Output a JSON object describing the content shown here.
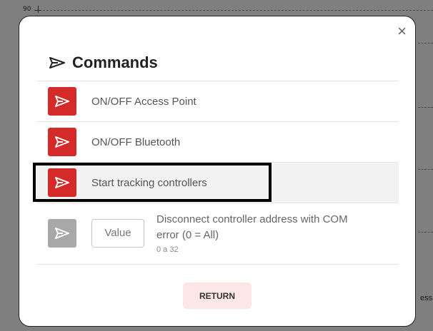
{
  "background": {
    "axis_label": "90",
    "right_text": "ess"
  },
  "modal": {
    "close_label": "×",
    "title": "Commands",
    "title_icon": "send-icon",
    "commands": [
      {
        "label": "ON/OFF Access Point",
        "icon": "send-icon",
        "color": "#d42a2a"
      },
      {
        "label": "ON/OFF Bluetooth",
        "icon": "send-icon",
        "color": "#d42a2a"
      },
      {
        "label": "Start tracking controllers",
        "icon": "send-icon",
        "color": "#d42a2a"
      }
    ],
    "param_command": {
      "input_placeholder": "Value",
      "description": "Disconnect controller address with COM error (0 = All)",
      "range": "0 a 32",
      "icon": "send-icon",
      "color": "#a8a8a8"
    },
    "return_label": "RETURN"
  }
}
